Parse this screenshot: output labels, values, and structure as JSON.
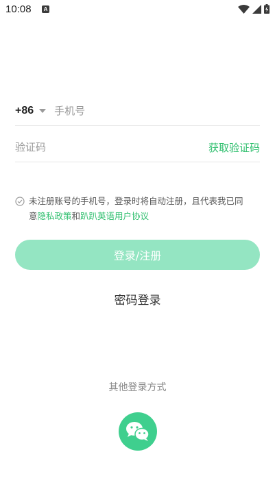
{
  "status_bar": {
    "time": "10:08",
    "notification_icon": "A"
  },
  "phone": {
    "country_code": "+86",
    "placeholder": "手机号"
  },
  "verification": {
    "placeholder": "验证码",
    "get_code_label": "获取验证码"
  },
  "agreement": {
    "text_line1": "未注册账号的手机号，登录时将自动注册，且代表我已同",
    "text_prefix": "意",
    "privacy_link": "隐私政策",
    "and": "和",
    "user_agreement_link": "趴趴英语用户协议"
  },
  "login_button": "登录/注册",
  "password_login": "密码登录",
  "other_methods": "其他登录方式",
  "colors": {
    "accent": "#2fbf6e",
    "button_disabled": "#94e5c2",
    "wechat": "#3fcf8e"
  }
}
